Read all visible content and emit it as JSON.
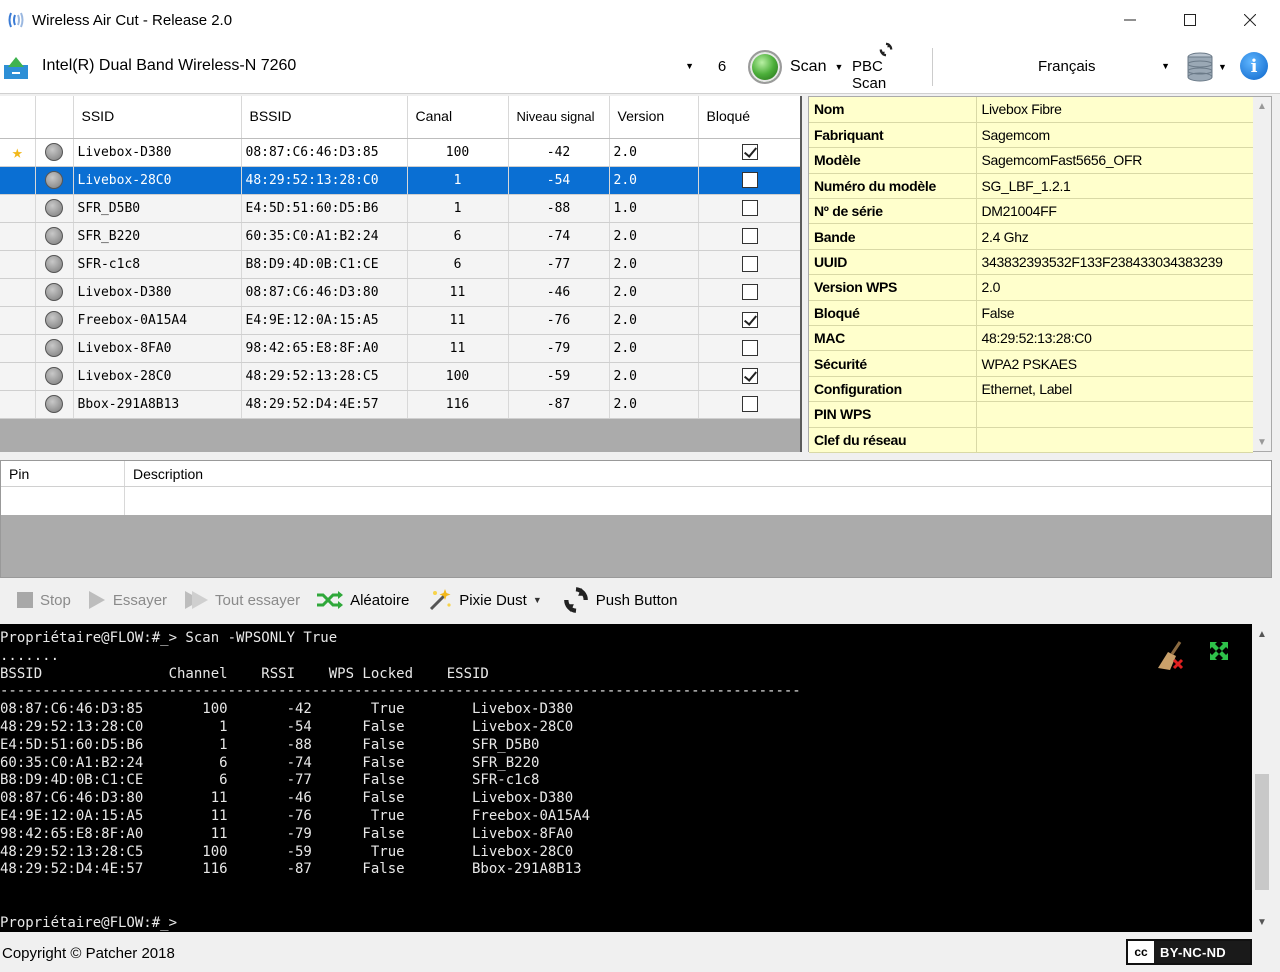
{
  "window": {
    "title": "Wireless Air Cut - Release 2.0"
  },
  "toolbar": {
    "adapter": "Intel(R) Dual Band Wireless-N 7260",
    "channel": "6",
    "scan_label": "Scan",
    "pbc_label": "PBC Scan",
    "language": "Français"
  },
  "networks": {
    "headers": {
      "ssid": "SSID",
      "bssid": "BSSID",
      "canal": "Canal",
      "signal": "Niveau signal",
      "version": "Version",
      "bloque": "Bloqué"
    },
    "rows": [
      {
        "starred": true,
        "ssid": "Livebox-D380",
        "bssid": "08:87:C6:46:D3:85",
        "canal": "100",
        "signal": "-42",
        "version": "2.0",
        "bloque": true,
        "selected": false
      },
      {
        "starred": false,
        "ssid": "Livebox-28C0",
        "bssid": "48:29:52:13:28:C0",
        "canal": "1",
        "signal": "-54",
        "version": "2.0",
        "bloque": false,
        "selected": true
      },
      {
        "starred": false,
        "ssid": "SFR_D5B0",
        "bssid": "E4:5D:51:60:D5:B6",
        "canal": "1",
        "signal": "-88",
        "version": "1.0",
        "bloque": false,
        "selected": false
      },
      {
        "starred": false,
        "ssid": "SFR_B220",
        "bssid": "60:35:C0:A1:B2:24",
        "canal": "6",
        "signal": "-74",
        "version": "2.0",
        "bloque": false,
        "selected": false
      },
      {
        "starred": false,
        "ssid": "SFR-c1c8",
        "bssid": "B8:D9:4D:0B:C1:CE",
        "canal": "6",
        "signal": "-77",
        "version": "2.0",
        "bloque": false,
        "selected": false
      },
      {
        "starred": false,
        "ssid": "Livebox-D380",
        "bssid": "08:87:C6:46:D3:80",
        "canal": "11",
        "signal": "-46",
        "version": "2.0",
        "bloque": false,
        "selected": false
      },
      {
        "starred": false,
        "ssid": "Freebox-0A15A4",
        "bssid": "E4:9E:12:0A:15:A5",
        "canal": "11",
        "signal": "-76",
        "version": "2.0",
        "bloque": true,
        "selected": false
      },
      {
        "starred": false,
        "ssid": "Livebox-8FA0",
        "bssid": "98:42:65:E8:8F:A0",
        "canal": "11",
        "signal": "-79",
        "version": "2.0",
        "bloque": false,
        "selected": false
      },
      {
        "starred": false,
        "ssid": "Livebox-28C0",
        "bssid": "48:29:52:13:28:C5",
        "canal": "100",
        "signal": "-59",
        "version": "2.0",
        "bloque": true,
        "selected": false
      },
      {
        "starred": false,
        "ssid": "Bbox-291A8B13",
        "bssid": "48:29:52:D4:4E:57",
        "canal": "116",
        "signal": "-87",
        "version": "2.0",
        "bloque": false,
        "selected": false
      }
    ]
  },
  "properties": [
    {
      "key": "Nom",
      "value": "Livebox Fibre"
    },
    {
      "key": "Fabriquant",
      "value": "Sagemcom"
    },
    {
      "key": "Modèle",
      "value": "SagemcomFast5656_OFR"
    },
    {
      "key": "Numéro du modèle",
      "value": "SG_LBF_1.2.1"
    },
    {
      "key": "Nº de série",
      "value": "DM21004FF"
    },
    {
      "key": "Bande",
      "value": "2.4 Ghz"
    },
    {
      "key": "UUID",
      "value": "343832393532F133F238433034383239"
    },
    {
      "key": "Version WPS",
      "value": "2.0"
    },
    {
      "key": "Bloqué",
      "value": "False"
    },
    {
      "key": "MAC",
      "value": "48:29:52:13:28:C0"
    },
    {
      "key": "Sécurité",
      "value": "WPA2 PSKAES"
    },
    {
      "key": "Configuration",
      "value": "Ethernet, Label"
    },
    {
      "key": "PIN WPS",
      "value": ""
    },
    {
      "key": "Clef du réseau",
      "value": ""
    }
  ],
  "pins": {
    "headers": {
      "pin": "Pin",
      "description": "Description"
    }
  },
  "actions": {
    "stop": "Stop",
    "essayer": "Essayer",
    "tout_essayer": "Tout essayer",
    "aleatoire": "Aléatoire",
    "pixie_dust": "Pixie Dust",
    "push_button": "Push Button"
  },
  "console": {
    "lines": [
      "Propriétaire@FLOW:#_> Scan -WPSONLY True",
      ".......",
      "BSSID               Channel    RSSI    WPS Locked    ESSID",
      "-----------------------------------------------------------------------------------------------",
      "08:87:C6:46:D3:85       100       -42       True        Livebox-D380",
      "48:29:52:13:28:C0         1       -54      False        Livebox-28C0",
      "E4:5D:51:60:D5:B6         1       -88      False        SFR_D5B0",
      "60:35:C0:A1:B2:24         6       -74      False        SFR_B220",
      "B8:D9:4D:0B:C1:CE         6       -77      False        SFR-c1c8",
      "08:87:C6:46:D3:80        11       -46      False        Livebox-D380",
      "E4:9E:12:0A:15:A5        11       -76       True        Freebox-0A15A4",
      "98:42:65:E8:8F:A0        11       -79      False        Livebox-8FA0",
      "48:29:52:13:28:C5       100       -59       True        Livebox-28C0",
      "48:29:52:D4:4E:57       116       -87      False        Bbox-291A8B13",
      "",
      "",
      "Propriétaire@FLOW:#_>"
    ]
  },
  "status": {
    "copyright": "Copyright © Patcher 2018",
    "license": "BY-NC-ND",
    "cc": "cc"
  }
}
